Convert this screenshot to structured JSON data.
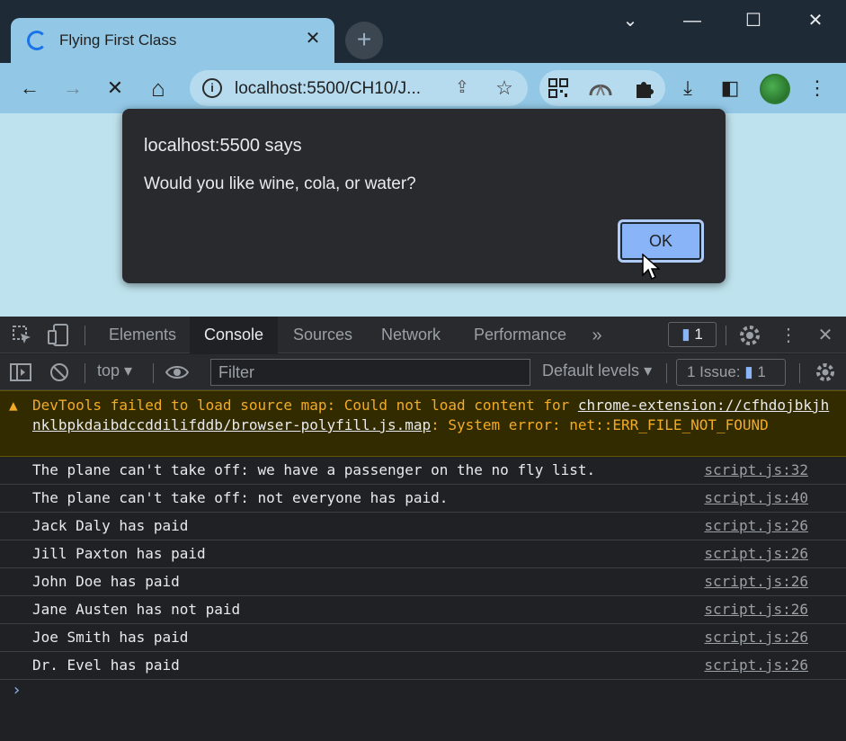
{
  "tab": {
    "title": "Flying First Class",
    "close_glyph": "✕"
  },
  "new_tab_glyph": "+",
  "window_controls": {
    "menu": "⌄",
    "minimize": "—",
    "maximize": "☐",
    "close": "✕"
  },
  "toolbar": {
    "back": "←",
    "forward": "→",
    "stop": "✕",
    "home": "⌂",
    "url": "localhost:5500/CH10/J...",
    "info_glyph": "i",
    "share_glyph": "⇪",
    "star_glyph": "☆",
    "download_glyph": "⤓",
    "sidepanel_glyph": "◧",
    "menu_glyph": "⋮"
  },
  "dialog": {
    "title": "localhost:5500 says",
    "message": "Would you like wine, cola, or water?",
    "ok_label": "OK"
  },
  "devtools": {
    "tabs": [
      "Elements",
      "Console",
      "Sources",
      "Network",
      "Performance"
    ],
    "active_tab": "Console",
    "more_glyph": "»",
    "message_count": "1",
    "context": "top",
    "filter_placeholder": "Filter",
    "levels": "Default levels",
    "issues_label": "1 Issue:",
    "issues_count": "1",
    "warning": {
      "text_before": "DevTools failed to load source map: Could not load content for ",
      "link": "chrome-extension://cfhdojbkjhnklbpkdaibdccddilifddb/browser-polyfill.js.map",
      "text_after": ": System error: net::ERR_FILE_NOT_FOUND"
    },
    "logs": [
      {
        "text": "The plane can't take off: we have a passenger on the no fly list.",
        "source": "script.js:32"
      },
      {
        "text": "The plane can't take off: not everyone has paid.",
        "source": "script.js:40"
      },
      {
        "text": "Jack Daly has paid",
        "source": "script.js:26"
      },
      {
        "text": "Jill Paxton has paid",
        "source": "script.js:26"
      },
      {
        "text": "John Doe has paid",
        "source": "script.js:26"
      },
      {
        "text": "Jane Austen has not paid",
        "source": "script.js:26"
      },
      {
        "text": "Joe Smith has paid",
        "source": "script.js:26"
      },
      {
        "text": "Dr. Evel has paid",
        "source": "script.js:26"
      }
    ],
    "prompt_glyph": "›"
  },
  "colors": {
    "accent": "#8ab4f8",
    "page_background": "#bfe3ee",
    "warning_text": "#f2ab26"
  }
}
